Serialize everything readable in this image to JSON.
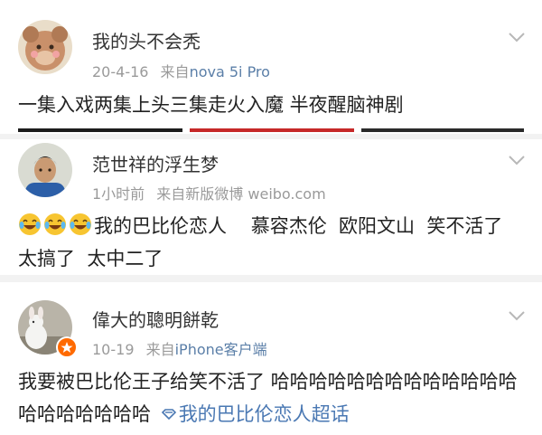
{
  "posts": [
    {
      "username": "我的头不会秃",
      "date": "20-4-16",
      "source_prefix": "来自",
      "source": "nova 5i Pro",
      "text": "一集入戏两集上头三集走火入魔 半夜醒脑神剧"
    },
    {
      "username": "范世祥的浮生梦",
      "date": "1小时前",
      "source_prefix": "来自",
      "source": "新版微博 weibo.com",
      "text": "我的巴比伦恋人    慕容杰伦  欧阳文山  笑不活了   太搞了  太中二了",
      "emoji": [
        "laugh-cry-emoji",
        "laugh-cry-emoji",
        "laugh-cry-emoji"
      ]
    },
    {
      "username": "偉大的聰明餅乾",
      "date": "10-19",
      "source_prefix": "来自",
      "source": "iPhone客户端",
      "text": "我要被巴比伦王子给笑不活了 哈哈哈哈哈哈哈哈哈哈哈哈哈哈哈哈哈哈哈哈",
      "topic_link": "我的巴比伦恋人超话"
    }
  ],
  "icons": {
    "menu": "chevron-down-icon",
    "topic": "diamond-topic-icon",
    "badge": "verified-badge-icon"
  },
  "colors": {
    "text": "#222222",
    "meta": "#9a9a9a",
    "link": "#4a78b3",
    "separator": "#f2f2f2"
  }
}
